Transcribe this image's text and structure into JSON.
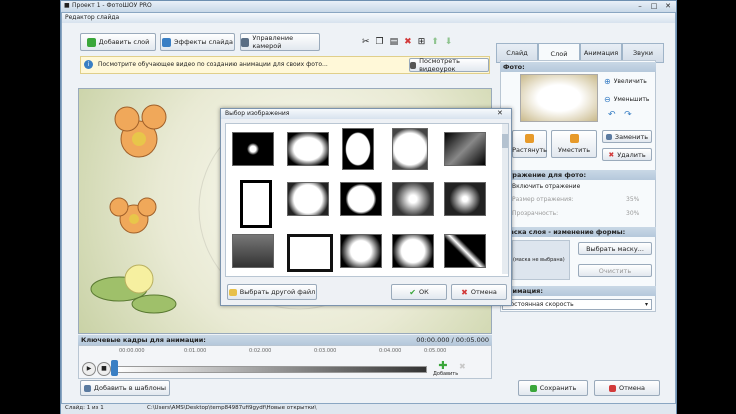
{
  "outer_window": {
    "title": "Проект 1 - ФотоШОУ PRO",
    "controls": [
      "–",
      "□",
      "✕"
    ]
  },
  "editor_window": {
    "title": "Редактор слайда",
    "controls": [
      "–",
      "□",
      "✕"
    ]
  },
  "toolbar": {
    "add_layer": "Добавить слой",
    "slide_effects": "Эффекты слайда",
    "camera_control": "Управление камерой"
  },
  "tabs": [
    "Слайд",
    "Слой",
    "Анимация",
    "Звуки"
  ],
  "active_tab": "Слой",
  "hint": {
    "text": "Посмотрите обучающее видео по созданию анимации для своих фото...",
    "button": "Посмотреть видеоурок"
  },
  "photo_section": {
    "header": "Фото:",
    "zoom_in": "Увеличить",
    "zoom_out": "Уменьшить",
    "stretch": "Растянуть",
    "fit": "Уместить",
    "replace": "Заменить",
    "delete": "Удалить"
  },
  "reflection": {
    "header": "Отражение для фото:",
    "enable": "Включить отражение",
    "size_label": "Размер отражения:",
    "size_value": "35%",
    "opacity_label": "Прозрачность:",
    "opacity_value": "30%"
  },
  "mask": {
    "header": "Маска слоя - изменение формы:",
    "choose": "Выбрать маску...",
    "none": "(маска не выбрана)",
    "clear": "Очистить"
  },
  "animation": {
    "header": "Анимация:",
    "speed": "Постоянная скорость"
  },
  "timeline": {
    "header": "Ключевые кадры для анимации:",
    "time": "00:00.000 / 00:05.000",
    "ticks": [
      "00:00.000",
      "0:01.000",
      "0:02.000",
      "0:03.000",
      "0:04.000",
      "0:05.000"
    ],
    "add": "Добавить"
  },
  "bottom": {
    "add_template": "Добавить в шаблоны",
    "save": "Сохранить",
    "cancel": "Отмена"
  },
  "status": {
    "slide": "Слайд: 1 из 1",
    "path": "C:\\Users\\AMS\\Desktop\\temp84987ufi9gydf\\Новые открытки\\"
  },
  "dialog": {
    "title": "Выбор изображения",
    "other_file": "Выбрать другой файл",
    "ok": "ОК",
    "cancel": "Отмена"
  },
  "colors": {
    "accent": "#3a7fc4",
    "green": "#3aa63a",
    "red": "#d23a3a",
    "orange": "#e79a2a"
  }
}
